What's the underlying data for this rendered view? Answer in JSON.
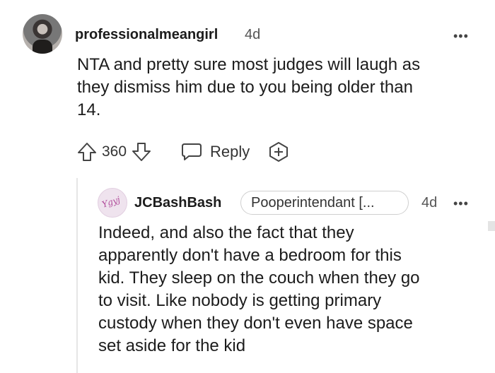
{
  "comment": {
    "username": "professionalmeangirl",
    "time": "4d",
    "more": "•••",
    "lines": [
      "NTA and pretty sure most judges will laugh as",
      "they dismiss him due to you being older than",
      "14."
    ],
    "votes": "360",
    "reply_label": "Reply",
    "icons": {
      "upvote": "arrow-up-icon",
      "downvote": "arrow-down-icon",
      "reply": "speech-bubble-icon",
      "award": "award-plus-icon"
    }
  },
  "reply": {
    "username": "JCBashBash",
    "flair": "Pooperintendant [...",
    "time": "4d",
    "more": "•••",
    "lines": [
      "Indeed, and also the fact that they",
      "apparently don't have a bedroom for this",
      "kid. They sleep on the couch when they go",
      "to visit. Like nobody is getting primary",
      "custody when they don't even have space",
      "set aside for the kid"
    ]
  },
  "colors": {
    "text": "#1c1c1c",
    "muted": "#555555",
    "thread_line": "#e6e6e6",
    "flair_border": "#cfcfcf"
  }
}
